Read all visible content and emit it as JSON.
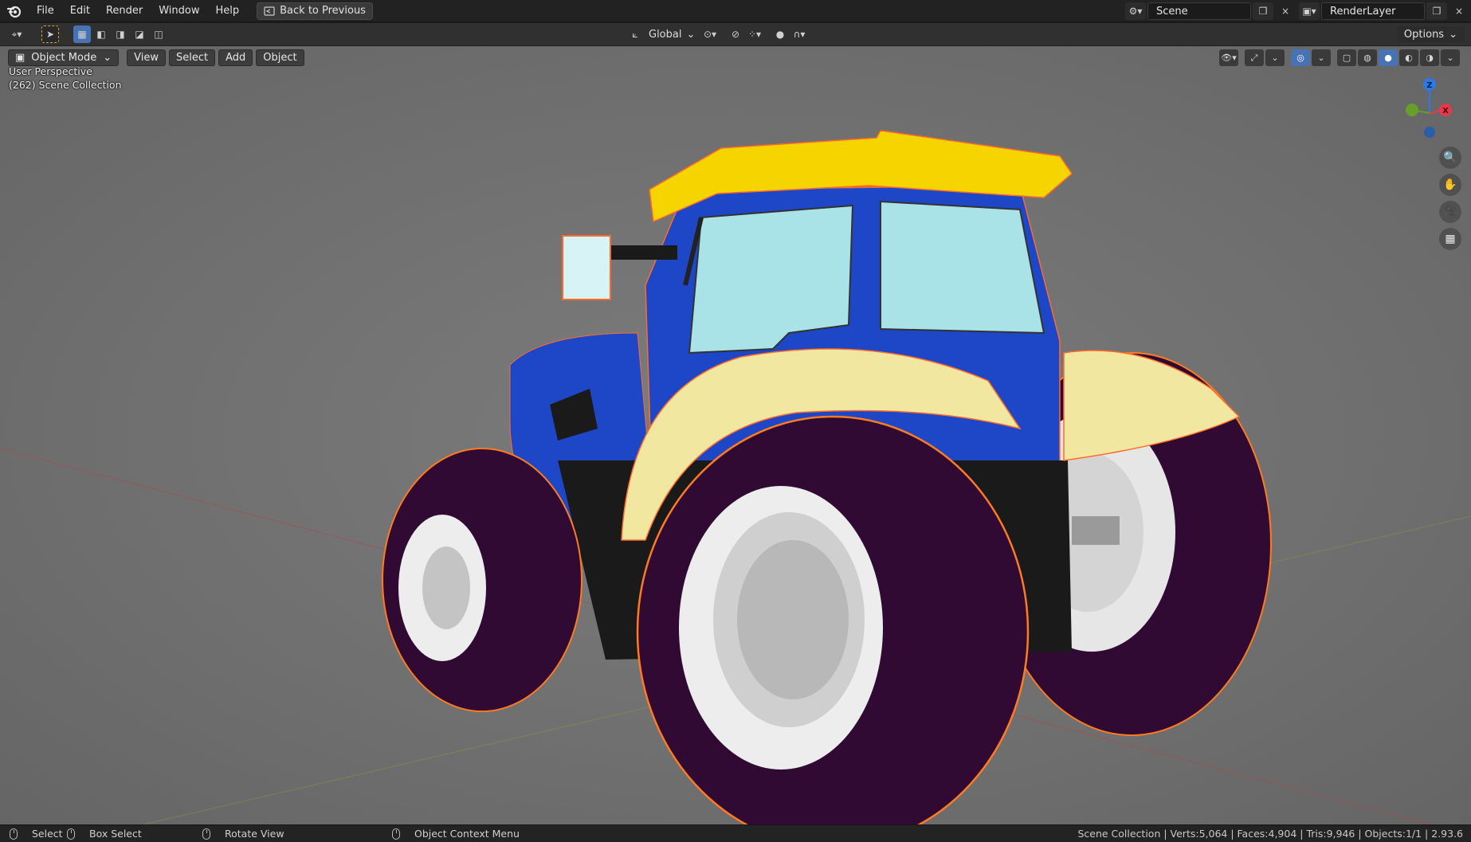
{
  "topbar": {
    "menu": [
      "File",
      "Edit",
      "Render",
      "Window",
      "Help"
    ],
    "back_label": "Back to Previous",
    "scene_value": "Scene",
    "render_layer_value": "RenderLayer"
  },
  "toolbar": {
    "transform_orientation": "Global",
    "options_label": "Options"
  },
  "viewport_header": {
    "mode_label": "Object Mode",
    "menus": [
      "View",
      "Select",
      "Add",
      "Object"
    ]
  },
  "overlay": {
    "perspective": "User Perspective",
    "collection": "(262) Scene Collection"
  },
  "gizmo": {
    "z_label": "Z",
    "x_label": "X",
    "colors": {
      "z": "#2a7be4",
      "x": "#e8394b",
      "y": "#6a9e2a"
    }
  },
  "statusbar": {
    "select": "Select",
    "box_select": "Box Select",
    "rotate_view": "Rotate View",
    "context_menu": "Object Context Menu",
    "stats": "Scene Collection | Verts:5,064 | Faces:4,904 | Tris:9,946 | Objects:1/1 | 2.93.6"
  },
  "scene": {
    "object": "tractor",
    "colors": {
      "cabin_blue": "#1e47c8",
      "roof_yellow": "#f5d400",
      "fender_cream": "#f2e7a0",
      "tire": "#300a33",
      "rim": "#e8e8e8",
      "glass": "#a9e3e8",
      "wire": "#ff6a2a",
      "selection": "#ff7a20"
    }
  }
}
